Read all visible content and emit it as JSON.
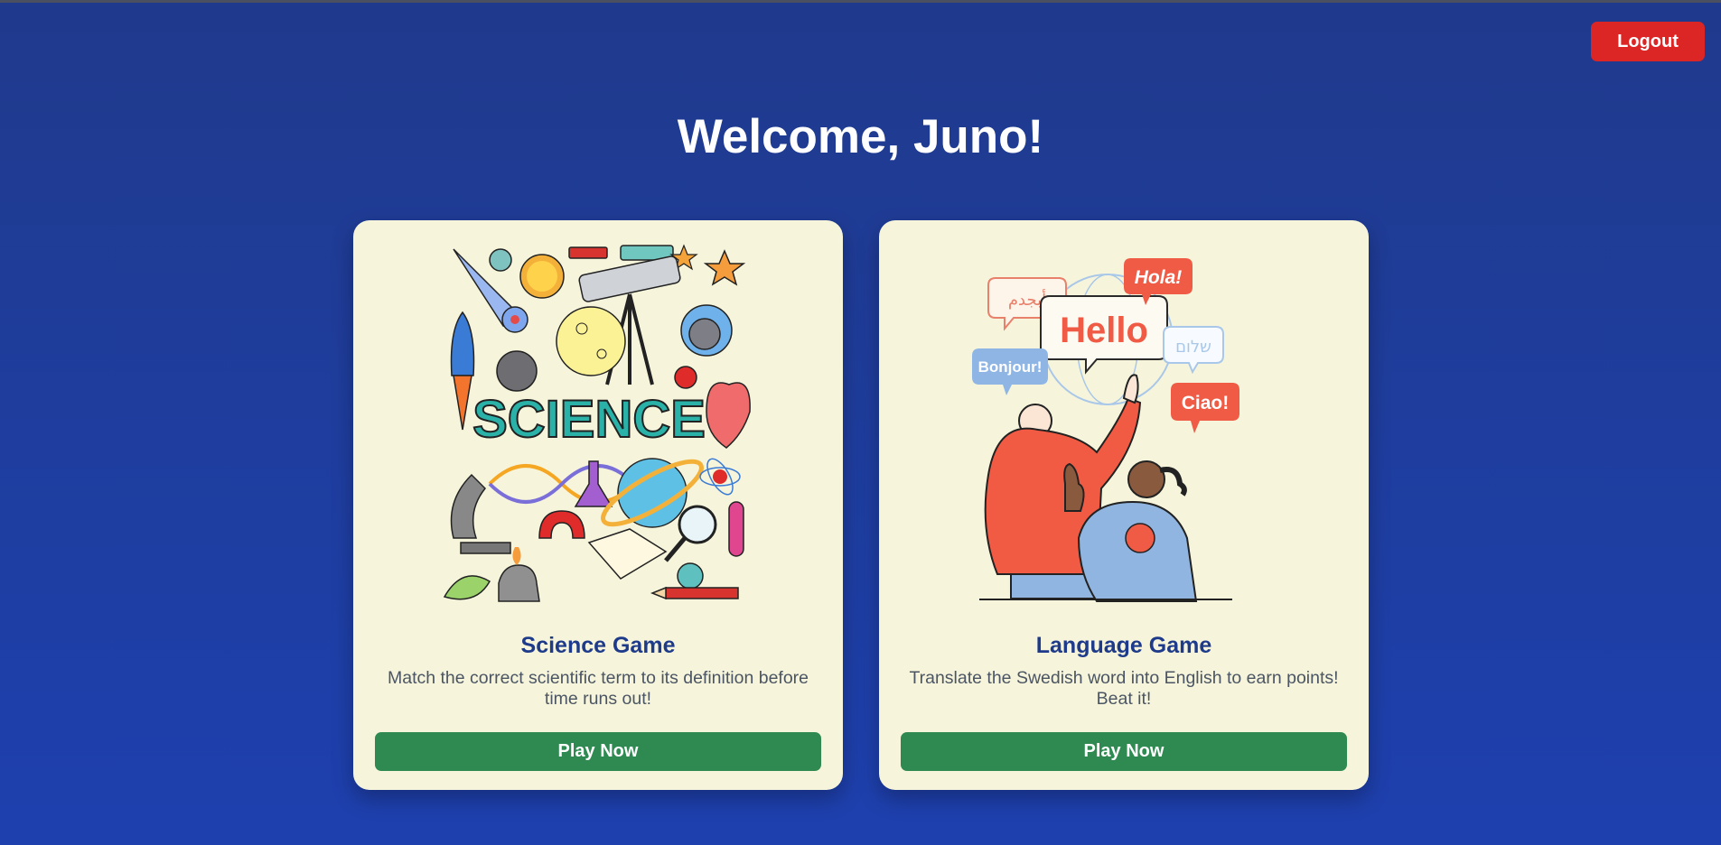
{
  "header": {
    "logout_label": "Logout"
  },
  "welcome": {
    "title": "Welcome, Juno!"
  },
  "games": [
    {
      "title": "Science Game",
      "description": "Match the correct scientific term to its definition before time runs out!",
      "button_label": "Play Now",
      "illustration_text": "SCIENCE"
    },
    {
      "title": "Language Game",
      "description": "Translate the Swedish word into English to earn points! Beat it!",
      "button_label": "Play Now",
      "bubbles": [
        "Hello",
        "Hola!",
        "Bonjour!",
        "Ciao!",
        "أبجدم",
        "שלום"
      ]
    }
  ],
  "colors": {
    "background": "#1e3a8a",
    "logout": "#dc2626",
    "card": "#f6f5dc",
    "play_button": "#2f8a52",
    "card_title": "#1e3a8a"
  }
}
